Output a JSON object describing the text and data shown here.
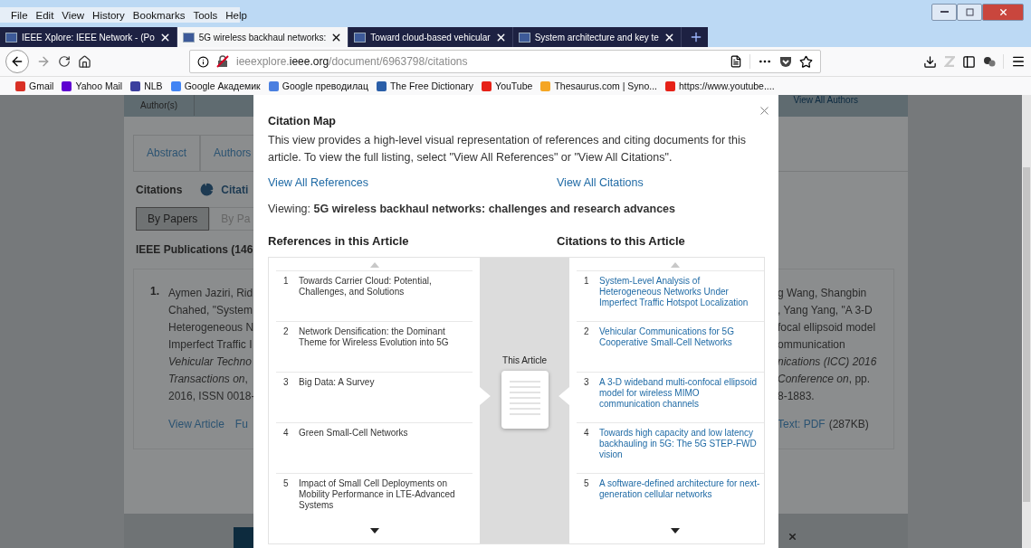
{
  "menu": [
    "File",
    "Edit",
    "View",
    "History",
    "Bookmarks",
    "Tools",
    "Help"
  ],
  "tabs": [
    {
      "title": "IEEE Xplore: IEEE Network - (Po",
      "selected": false
    },
    {
      "title": "5G wireless backhaul networks:",
      "selected": true
    },
    {
      "title": "Toward cloud-based vehicular",
      "selected": false
    },
    {
      "title": "System architecture and key te",
      "selected": false
    }
  ],
  "address": {
    "host_start": "ieeexplore.",
    "domain": "ieee.org",
    "path": "/document/6963798/citations"
  },
  "bookmarks": [
    {
      "label": "Gmail",
      "color": "#d93025"
    },
    {
      "label": "Yahoo Mail",
      "color": "#5f01d1"
    },
    {
      "label": "NLB",
      "color": "#3b3f9e"
    },
    {
      "label": "Google Академик",
      "color": "#4285f4"
    },
    {
      "label": "Google преводилац",
      "color": "#4a7fe0"
    },
    {
      "label": "The Free Dictionary",
      "color": "#2a5ea8"
    },
    {
      "label": "YouTube",
      "color": "#e62117"
    },
    {
      "label": "Thesaurus.com | Syno...",
      "color": "#f5a623"
    },
    {
      "label": "https://www.youtube....",
      "color": "#e62117"
    }
  ],
  "page": {
    "author_header": "Author(s)",
    "view_all_authors": "View All Authors",
    "tabs": [
      {
        "label": "Abstract",
        "selected": false
      },
      {
        "label": "Authors",
        "selected": false
      }
    ],
    "citations_label": "Citations",
    "citations_link": "Citati",
    "view_buttons": [
      {
        "label": "By Papers",
        "selected": true
      },
      {
        "label": "By Pa",
        "selected": false
      }
    ],
    "publications_heading": "IEEE Publications (146",
    "result": {
      "number": "1.",
      "left_lines": [
        {
          "text": "Aymen Jaziri, Rid",
          "italic": false
        },
        {
          "text": "Chahed, \"System",
          "italic": false
        },
        {
          "text": "Heterogeneous N",
          "italic": false
        },
        {
          "text": "Imperfect Traffic I",
          "italic": false
        },
        {
          "text": "Vehicular Techno",
          "italic": true
        },
        {
          "text": "*Transactions on*,",
          "italic": false
        },
        {
          "text": "2016, ISSN 0018-",
          "italic": false
        }
      ],
      "right_lines": [
        {
          "text": "g Wang, Shangbin",
          "italic": false
        },
        {
          "text": ", Yang Yang, \"A 3-D",
          "italic": false
        },
        {
          "text": "focal ellipsoid model",
          "italic": false
        },
        {
          "text": "ommunication",
          "italic": false
        },
        {
          "text": "nications (ICC) 2016",
          "italic": true
        },
        {
          "text": "*Conference on*, pp.",
          "italic": false
        },
        {
          "text": "8-1883.",
          "italic": false
        }
      ],
      "left_links": [
        "View Article",
        "Fu"
      ],
      "right_link": "Text: PDF",
      "right_size": "(287KB)"
    }
  },
  "dialog": {
    "title": "Citation Map",
    "description": "This view provides a high-level visual representation of references and citing documents for this article. To view the full listing, select \"View All References\" or \"View All Citations\".",
    "links": [
      "View All References",
      "View All Citations"
    ],
    "viewing": "Viewing: **5G wireless backhaul networks: challenges and research advances**",
    "references_heading": "References in this Article",
    "citations_heading": "Citations to this Article",
    "center_label": "This Article",
    "references": [
      {
        "number": "1",
        "title": "Towards Carrier Cloud: Potential, Challenges, and Solutions"
      },
      {
        "number": "2",
        "title": "Network Densification: the Dominant Theme for Wireless Evolution into 5G"
      },
      {
        "number": "3",
        "title": "Big Data: A Survey"
      },
      {
        "number": "4",
        "title": "Green Small-Cell Networks"
      },
      {
        "number": "5",
        "title": "Impact of Small Cell Deployments on Mobility Performance in LTE-Advanced Systems"
      }
    ],
    "citations": [
      {
        "number": "1",
        "title": "System-Level Analysis of Heterogeneous Networks Under Imperfect Traffic Hotspot Localization"
      },
      {
        "number": "2",
        "title": "Vehicular Communications for 5G Cooperative Small-Cell Networks"
      },
      {
        "number": "3",
        "title": "A 3-D wideband multi-confocal ellipsoid model for wireless MIMO communication channels"
      },
      {
        "number": "4",
        "title": "Towards high capacity and low latency backhauling in 5G: The 5G STEP-FWD vision"
      },
      {
        "number": "5",
        "title": "A software-defined architecture for next-generation cellular networks"
      }
    ]
  }
}
